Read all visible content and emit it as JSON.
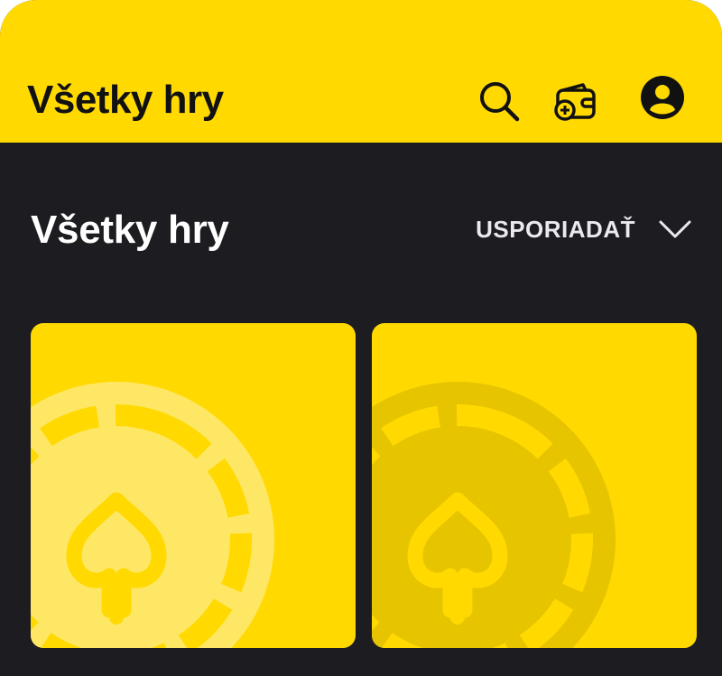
{
  "header": {
    "title": "Všetky hry",
    "icons": {
      "search": "search-icon",
      "wallet": "wallet-add-icon",
      "profile": "user-icon"
    },
    "background": "#ffd900"
  },
  "section": {
    "title": "Všetky hry",
    "sort_label": "USPORIADAŤ",
    "sort_icon": "chevron-down-icon"
  },
  "games": [
    {
      "thumbnail_icon": "poker-chip-icon",
      "variant": "light"
    },
    {
      "thumbnail_icon": "poker-chip-icon",
      "variant": "dark"
    }
  ],
  "colors": {
    "accent": "#ffd900",
    "background": "#1c1c21",
    "text_light": "#ffffff",
    "text_dark": "#111111"
  }
}
